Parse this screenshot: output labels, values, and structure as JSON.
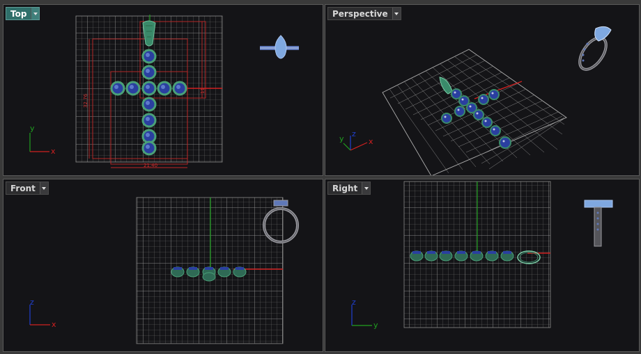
{
  "viewports": {
    "top": {
      "label": "Top",
      "active": true
    },
    "perspective": {
      "label": "Perspective",
      "active": false
    },
    "front": {
      "label": "Front",
      "active": false
    },
    "right": {
      "label": "Right",
      "active": false
    }
  },
  "dimensions": {
    "width": "21.40",
    "height": "32.76",
    "side": "11"
  },
  "axes": {
    "top": {
      "x": "x",
      "y": "y"
    },
    "perspective": {
      "x": "x",
      "y": "y",
      "z": "z"
    },
    "front": {
      "x": "x",
      "z": "z"
    },
    "right": {
      "y": "y",
      "z": "z"
    }
  },
  "icons": {
    "dropdown": "chevron-down-icon",
    "ring_preview": "ring-preview-icon"
  },
  "colors": {
    "active_tab": "#2f6f6a",
    "viewport_bg": "#141417",
    "grid": "#8a8a8a",
    "x_axis": "#d02020",
    "y_axis": "#20a020",
    "z_axis": "#2040d0",
    "gem_blue": "#2a3fa0",
    "setting_green": "#3a8a6a",
    "metal": "#9a9aa0",
    "stone_light": "#7fa8e0"
  }
}
